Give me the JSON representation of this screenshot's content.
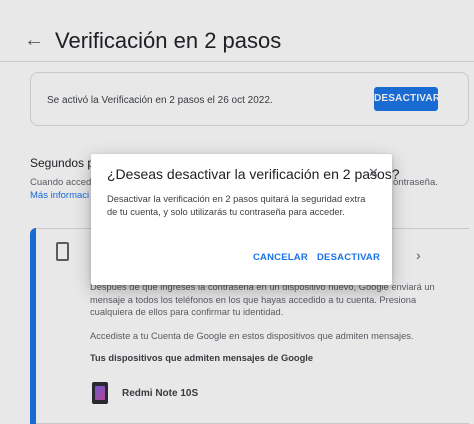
{
  "header": {
    "title": "Verificación en 2 pasos"
  },
  "status": {
    "text": "Se activó la Verificación en 2 pasos el 26 oct 2022.",
    "button_label": "DESACTIVAR"
  },
  "section": {
    "title": "Segundos pa",
    "desc_left": "Cuando acced",
    "desc_right": "ontraseña.",
    "link": "Más informaci"
  },
  "method": {
    "paragraph_1": "Después de que ingreses la contraseña en un dispositivo nuevo, Google enviará un mensaje a todos los teléfonos en los que hayas accedido a tu cuenta. Presiona cualquiera de ellos para confirmar tu identidad.",
    "paragraph_2": "Accediste a tu Cuenta de Google en estos dispositivos que admiten mensajes.",
    "devices_heading": "Tus dispositivos que admiten mensajes de Google",
    "device_name": "Redmi Note 10S"
  },
  "dialog": {
    "title": "¿Deseas desactivar la verificación en 2 pasos?",
    "body": "Desactivar la verificación en 2 pasos quitará la seguridad extra de tu cuenta, y solo utilizarás tu contraseña para acceder.",
    "cancel_label": "CANCELAR",
    "confirm_label": "DESACTIVAR"
  },
  "colors": {
    "accent": "#1a73e8"
  }
}
